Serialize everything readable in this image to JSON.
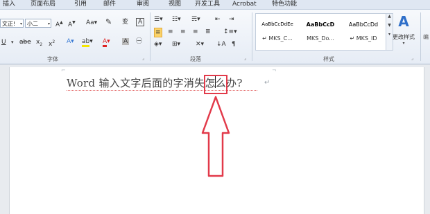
{
  "tabs": [
    "插入",
    "页面布局",
    "引用",
    "邮件",
    "审阅",
    "视图",
    "开发工具",
    "Acrobat",
    "特色功能"
  ],
  "font": {
    "name": "文正!",
    "size": "小二",
    "group_label": "字体"
  },
  "paragraph": {
    "group_label": "段落"
  },
  "styles": {
    "group_label": "样式",
    "items": [
      {
        "sample": "AaBbCcDdEe",
        "name": "↵ MKS_C..."
      },
      {
        "sample": "AaBbCcD",
        "name": "MKS_Do..."
      },
      {
        "sample": "AaBbCcDd",
        "name": "↵ MKS_ID"
      }
    ],
    "change_label": "更改样式"
  },
  "document": {
    "text": "Word 输入文字后面的字消失怎么办?"
  },
  "colors": {
    "annotation": "#e23a4a",
    "ribbon_bg": "#e6ecf5"
  }
}
